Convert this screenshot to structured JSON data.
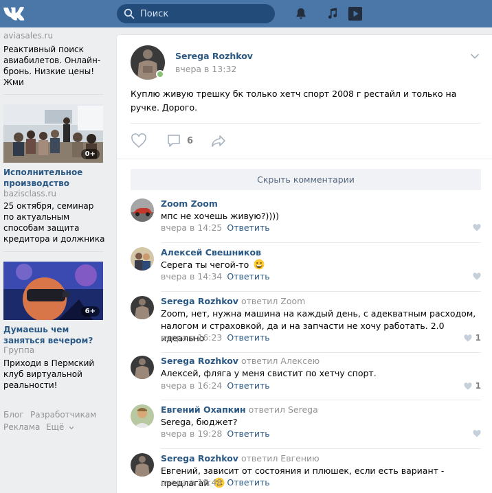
{
  "colors": {
    "topbar": "#4a76a8",
    "link": "#2a5885",
    "muted": "#939393",
    "online": "#8ac176"
  },
  "topbar": {
    "search_placeholder": "Поиск"
  },
  "ads": [
    {
      "domain": "aviasales.ru",
      "text": "Реактивный поиск авиабилетов. Онлайн-бронь. Низкие цены! Жми"
    },
    {
      "badge": "0+",
      "title": "Исполнительное производство",
      "domain": "bazisclass.ru",
      "text": "25 октября, семинар по актуальным способам защита кредитора и должника"
    },
    {
      "badge": "6+",
      "title": "Думаешь чем заняться вечером?",
      "domain": "Группа",
      "text": "Приходи в Пермский клуб виртуальной реальности!"
    }
  ],
  "footer": {
    "blog": "Блог",
    "developers": "Разработчикам",
    "ads": "Реклама",
    "more": "Ещё"
  },
  "post": {
    "author": "Serega Rozhkov",
    "date": "вчера в 13:32",
    "text": "Куплю живую трешку бк только хетч спорт 2008 г рестайл и только на ручке. Дорого.",
    "comments_count": "6",
    "hide_comments": "Скрыть комментарии"
  },
  "reply_label": "Ответить",
  "comments": [
    {
      "author": "Zoom Zoom",
      "reply_to": "",
      "text": "мпс не хочешь живую?))))",
      "time": "вчера в 14:25",
      "likes": ""
    },
    {
      "author": "Алексей Свешников",
      "reply_to": "",
      "text": "Серега ты чегой-то",
      "time": "вчера в 14:34",
      "likes": ""
    },
    {
      "author": "Serega Rozhkov",
      "reply_to": "ответил Zoom",
      "text": "Zoom, нет, нужна машина на каждый день, с адекватным расходом, налогом и страховкой, да и на запчасти не хочу работать. 2.0 идеально",
      "time": "вчера в 16:23",
      "likes": "1"
    },
    {
      "author": "Serega Rozhkov",
      "reply_to": "ответил Алексею",
      "text": "Алексей, фляга у меня свистит по хетчу спорт.",
      "time": "вчера в 16:24",
      "likes": "1"
    },
    {
      "author": "Евгений Охапкин",
      "reply_to": "ответил Serega",
      "text": "Serega, бюджет?",
      "time": "вчера в 19:28",
      "likes": ""
    },
    {
      "author": "Serega Rozhkov",
      "reply_to": "ответил Евгению",
      "text": "Евгений, зависит от состояния и плюшек, если есть вариант - предлагай",
      "time": "вчера в 19:48",
      "likes": ""
    }
  ]
}
